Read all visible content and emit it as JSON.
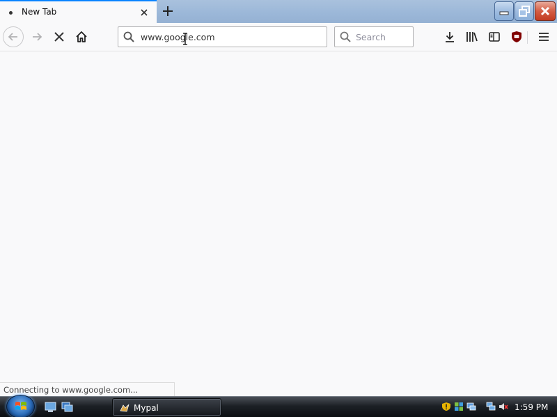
{
  "tab": {
    "title": "New Tab"
  },
  "urlbar": {
    "value": "www.google.com"
  },
  "searchbar": {
    "placeholder": "Search"
  },
  "status": {
    "text": "Connecting to www.google.com..."
  },
  "taskbar": {
    "task_label": "Mypal",
    "clock": "1:59 PM"
  },
  "colors": {
    "tab_accent": "#0a84ff",
    "titlebar": "#9bb7d8",
    "ublock": "#800000",
    "close_button": "#c23b21"
  },
  "icons": [
    "tab-loading-dot",
    "close-icon",
    "plus-icon",
    "minimize-icon",
    "restore-icon",
    "close-window-icon",
    "back-arrow-icon",
    "forward-arrow-icon",
    "stop-icon",
    "home-icon",
    "search-icon",
    "download-icon",
    "library-icon",
    "sidebar-icon",
    "ublock-origin-icon",
    "hamburger-menu-icon",
    "windows-start-icon"
  ]
}
